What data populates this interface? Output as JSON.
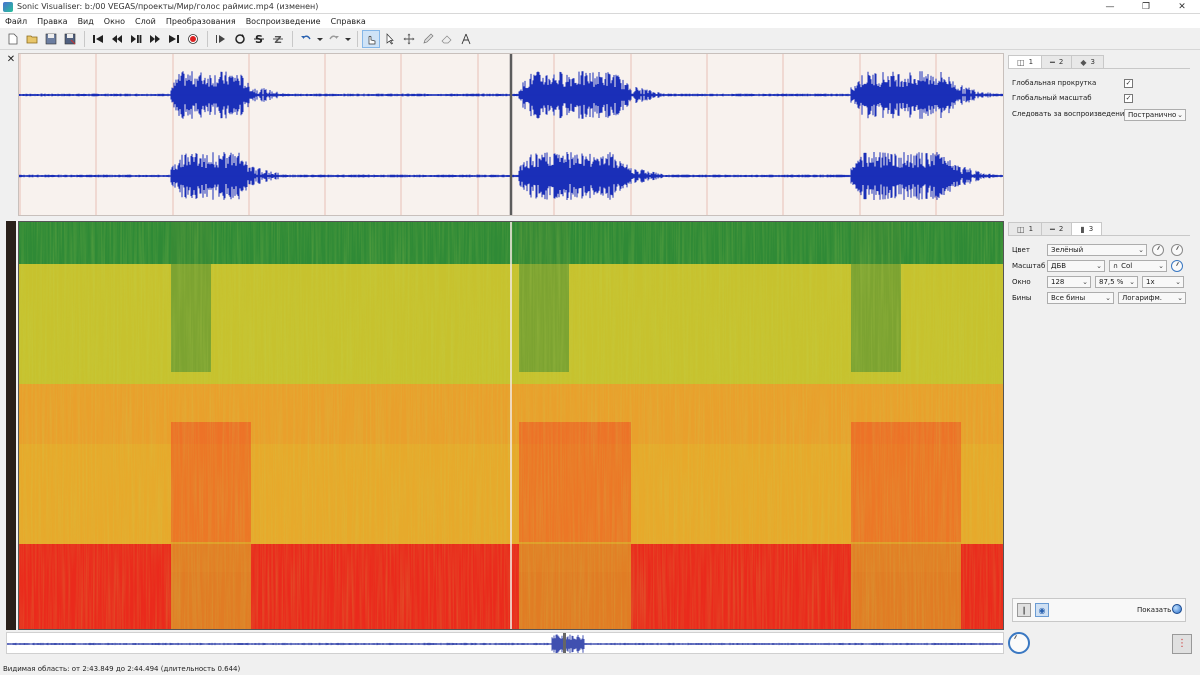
{
  "window": {
    "title": "Sonic Visualiser: b:/00 VEGAS/проекты/Мир/голос раймис.mp4 (изменен)",
    "controls": [
      "minimize-icon",
      "maximize-icon",
      "close-icon"
    ]
  },
  "menu": [
    "Файл",
    "Правка",
    "Вид",
    "Окно",
    "Слой",
    "Преобразования",
    "Воспроизведение",
    "Справка"
  ],
  "toolbar": {
    "icons": [
      "new-file-icon",
      "open-icon",
      "save-icon",
      "save-as-icon",
      "rewind-start-icon",
      "rewind-icon",
      "play-pause-icon",
      "fast-forward-icon",
      "ffwd-end-icon",
      "record-icon",
      "play-selection-icon",
      "loop-icon",
      "solo-icon",
      "normalize-icon",
      "undo-icon",
      "redo-icon",
      "navigate-icon",
      "select-icon",
      "move-icon",
      "draw-icon",
      "erase-icon",
      "measure-icon"
    ]
  },
  "top_panel": {
    "tabs": [
      "1",
      "2",
      "3"
    ],
    "global_scroll_label": "Глобальная прокрутка",
    "global_scroll_checked": true,
    "global_zoom_label": "Глобальный масштаб",
    "global_zoom_checked": true,
    "follow_label": "Следовать за воспроизведением",
    "follow_value": "Постранично"
  },
  "spec_panel": {
    "tabs": [
      "1",
      "2",
      "3"
    ],
    "color_label": "Цвет",
    "color_value": "Зелёный",
    "scale_label": "Масштаб",
    "scale_value": "ДБВ",
    "scale_extra": "Col",
    "window_label": "Окно",
    "window_size": "128",
    "window_overlap": "87,5 %",
    "window_oversample": "1x",
    "bins_label": "Бины",
    "bins_value": "Все бины",
    "bins_scale": "Логарифм.",
    "show_label": "Показать"
  },
  "status": {
    "text": "Видимая область: от 2:43.849 до 2:44.494 (длительность 0.644)"
  },
  "colors": {
    "waveform": "#1a2fb8",
    "spec_green": "#2f8a36",
    "spec_yellow": "#c7c22e",
    "spec_red": "#ea2a1c"
  }
}
